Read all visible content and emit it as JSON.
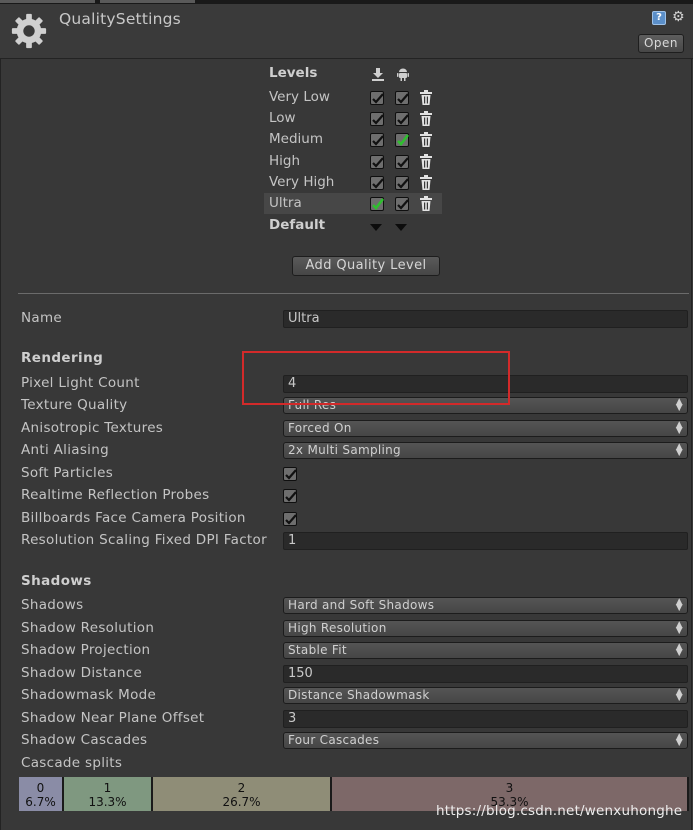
{
  "window": {
    "title": "QualitySettings",
    "open_label": "Open",
    "help_icon_label": "?",
    "settings_icon": "gear-icon"
  },
  "levels": {
    "header": "Levels",
    "column_icons": [
      "download-icon",
      "android-icon"
    ],
    "rows": [
      {
        "name": "Very Low",
        "standalone": "checked",
        "android": "checked"
      },
      {
        "name": "Low",
        "standalone": "checked",
        "android": "checked"
      },
      {
        "name": "Medium",
        "standalone": "checked",
        "android": "default-green"
      },
      {
        "name": "High",
        "standalone": "checked",
        "android": "checked"
      },
      {
        "name": "Very High",
        "standalone": "checked",
        "android": "checked"
      },
      {
        "name": "Ultra",
        "standalone": "default-green",
        "android": "checked",
        "selected": true
      }
    ],
    "default_label": "Default",
    "add_button": "Add Quality Level"
  },
  "name_field": {
    "label": "Name",
    "value": "Ultra"
  },
  "rendering": {
    "header": "Rendering",
    "pixel_light_count": {
      "label": "Pixel Light Count",
      "value": "4"
    },
    "texture_quality": {
      "label": "Texture Quality",
      "value": "Full Res"
    },
    "anisotropic": {
      "label": "Anisotropic Textures",
      "value": "Forced On"
    },
    "anti_aliasing": {
      "label": "Anti Aliasing",
      "value": "2x Multi Sampling"
    },
    "soft_particles": {
      "label": "Soft Particles",
      "checked": true
    },
    "reflection_probes": {
      "label": "Realtime Reflection Probes",
      "checked": true
    },
    "billboards": {
      "label": "Billboards Face Camera Position",
      "checked": true
    },
    "dpi_factor": {
      "label": "Resolution Scaling Fixed DPI Factor",
      "value": "1"
    }
  },
  "shadows": {
    "header": "Shadows",
    "shadows": {
      "label": "Shadows",
      "value": "Hard and Soft Shadows"
    },
    "resolution": {
      "label": "Shadow Resolution",
      "value": "High Resolution"
    },
    "projection": {
      "label": "Shadow Projection",
      "value": "Stable Fit"
    },
    "distance": {
      "label": "Shadow Distance",
      "value": "150"
    },
    "shadowmask": {
      "label": "Shadowmask Mode",
      "value": "Distance Shadowmask"
    },
    "near_plane": {
      "label": "Shadow Near Plane Offset",
      "value": "3"
    },
    "cascades": {
      "label": "Shadow Cascades",
      "value": "Four Cascades"
    },
    "cascade_splits_label": "Cascade splits",
    "splits": [
      {
        "index": "0",
        "percent": "6.7%",
        "fraction": 0.067,
        "color": "#8a8ca6"
      },
      {
        "index": "1",
        "percent": "13.3%",
        "fraction": 0.133,
        "color": "#7f9880"
      },
      {
        "index": "2",
        "percent": "26.7%",
        "fraction": 0.267,
        "color": "#8f8d77"
      },
      {
        "index": "3",
        "percent": "53.3%",
        "fraction": 0.533,
        "color": "#7d6868"
      }
    ]
  },
  "watermark": "https://blog.csdn.net/wenxuhonghe",
  "colors": {
    "background": "#383838",
    "highlight_box": "#d32a2a",
    "default_check": "#2fbf2f"
  }
}
